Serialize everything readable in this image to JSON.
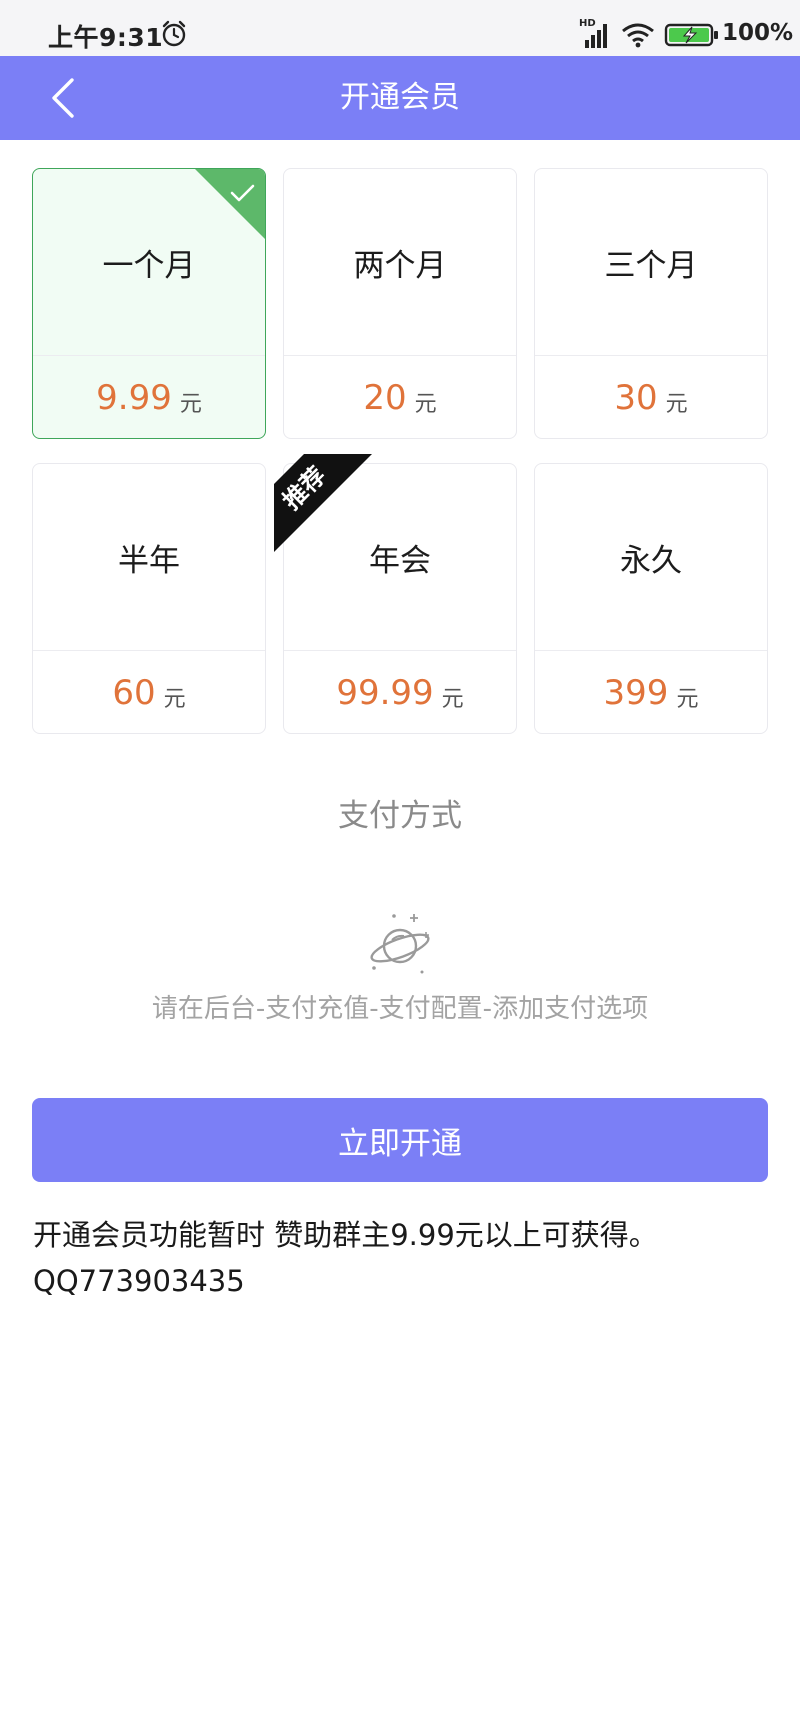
{
  "status_bar": {
    "time": "上午9:31",
    "network": "HD",
    "battery": "100%"
  },
  "header": {
    "title": "开通会员"
  },
  "plans": [
    {
      "name": "一个月",
      "price": "9.99",
      "unit": "元",
      "selected": true
    },
    {
      "name": "两个月",
      "price": "20",
      "unit": "元"
    },
    {
      "name": "三个月",
      "price": "30",
      "unit": "元"
    },
    {
      "name": "半年",
      "price": "60",
      "unit": "元"
    },
    {
      "name": "年会",
      "price": "99.99",
      "unit": "元",
      "badge": "推荐"
    },
    {
      "name": "永久",
      "price": "399",
      "unit": "元"
    }
  ],
  "payment": {
    "title": "支付方式",
    "empty_hint": "请在后台-支付充值-支付配置-添加支付选项",
    "empty_icon": "planet-icon"
  },
  "submit_label": "立即开通",
  "notice": {
    "line1": "开通会员功能暂时 赞助群主9.99元以上可获得。",
    "line2": "QQ773903435"
  },
  "colors": {
    "primary": "#7b7ff6",
    "price": "#e0733a",
    "selected_border": "#3fa65a",
    "selected_bg": "#f1fcf4",
    "badge": "#111111"
  }
}
